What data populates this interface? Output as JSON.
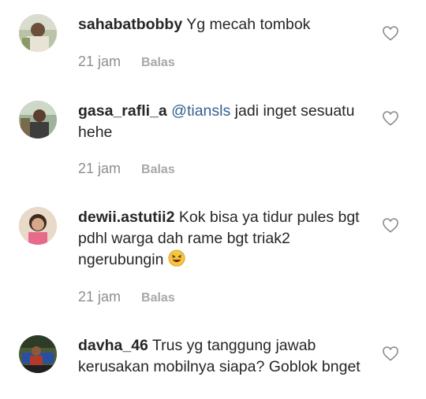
{
  "comments": [
    {
      "username": "sahabatbobby",
      "mention": "",
      "text": "Yg mecah tombok",
      "time": "21 jam",
      "reply_label": "Balas"
    },
    {
      "username": "gasa_rafli_a",
      "mention": "@tiansls",
      "text": "jadi inget sesuatu hehe",
      "time": "21 jam",
      "reply_label": "Balas"
    },
    {
      "username": "dewii.astutii2",
      "mention": "",
      "text": "Kok bisa ya tidur pules bgt pdhl warga dah rame bgt triak2 ngerubungin",
      "emoji": "laughing-sweat-emoji",
      "time": "21 jam",
      "reply_label": "Balas"
    },
    {
      "username": "davha_46",
      "mention": "",
      "text": "Trus yg tanggung jawab kerusakan mobilnya siapa? Goblok bnget",
      "time": "",
      "reply_label": ""
    }
  ],
  "icons": {
    "like": "heart-outline-icon"
  },
  "colors": {
    "text": "#262626",
    "meta": "#8e8e8e",
    "mention": "#34618f"
  }
}
